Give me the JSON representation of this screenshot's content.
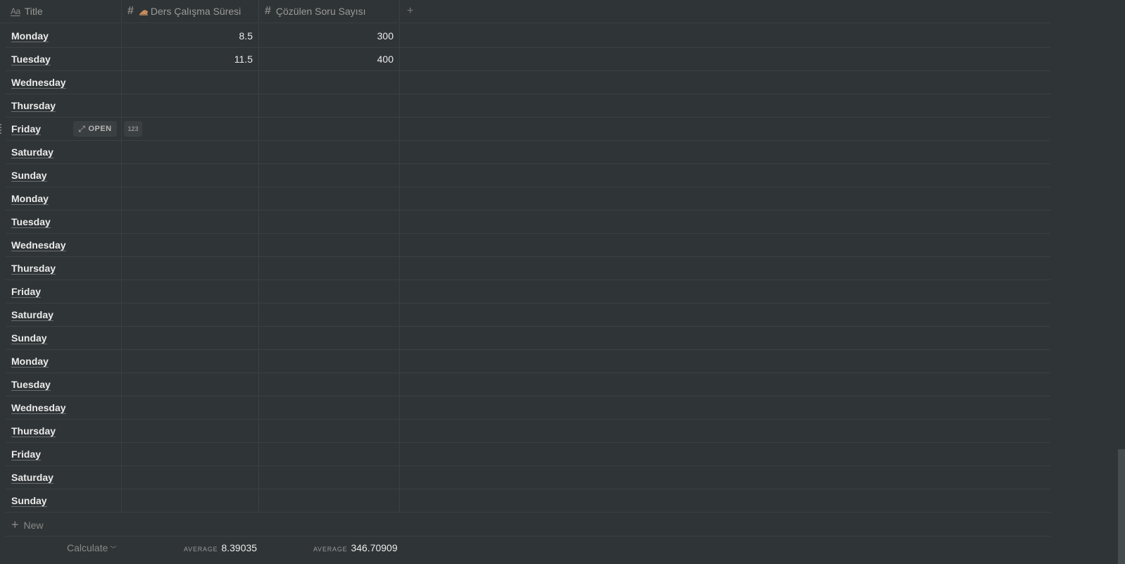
{
  "header": {
    "title_label": "Title",
    "col_ders_label": "Ders Çalışma Süresi",
    "col_soru_label": "Çözülen Soru Sayısı",
    "title_icon": "text-aa-icon",
    "number_icon": "hash-icon",
    "add_icon": "plus-icon"
  },
  "rows": [
    {
      "title": "Monday",
      "ders": "8.5",
      "soru": "300"
    },
    {
      "title": "Tuesday",
      "ders": "11.5",
      "soru": "400"
    },
    {
      "title": "Wednesday",
      "ders": "",
      "soru": ""
    },
    {
      "title": "Thursday",
      "ders": "",
      "soru": ""
    },
    {
      "title": "Friday",
      "ders": "",
      "soru": ""
    },
    {
      "title": "Saturday",
      "ders": "",
      "soru": ""
    },
    {
      "title": "Sunday",
      "ders": "",
      "soru": ""
    },
    {
      "title": "Monday",
      "ders": "",
      "soru": ""
    },
    {
      "title": "Tuesday",
      "ders": "",
      "soru": ""
    },
    {
      "title": "Wednesday",
      "ders": "",
      "soru": ""
    },
    {
      "title": "Thursday",
      "ders": "",
      "soru": ""
    },
    {
      "title": "Friday",
      "ders": "",
      "soru": ""
    },
    {
      "title": "Saturday",
      "ders": "",
      "soru": ""
    },
    {
      "title": "Sunday",
      "ders": "",
      "soru": ""
    },
    {
      "title": "Monday",
      "ders": "",
      "soru": ""
    },
    {
      "title": "Tuesday",
      "ders": "",
      "soru": ""
    },
    {
      "title": "Wednesday",
      "ders": "",
      "soru": ""
    },
    {
      "title": "Thursday",
      "ders": "",
      "soru": ""
    },
    {
      "title": "Friday",
      "ders": "",
      "soru": ""
    },
    {
      "title": "Saturday",
      "ders": "",
      "soru": ""
    },
    {
      "title": "Sunday",
      "ders": "",
      "soru": ""
    }
  ],
  "hover_row": {
    "open_label": "OPEN",
    "number_badge": "123"
  },
  "new_row": {
    "label": "New"
  },
  "footer": {
    "calculate_label": "Calculate",
    "ders_caption": "AVERAGE",
    "ders_value": "8.39035",
    "soru_caption": "AVERAGE",
    "soru_value": "346.70909"
  },
  "colors": {
    "background": "#2f3437",
    "border": "#3b4043",
    "text": "#ebebea",
    "muted": "#9b9a97"
  }
}
